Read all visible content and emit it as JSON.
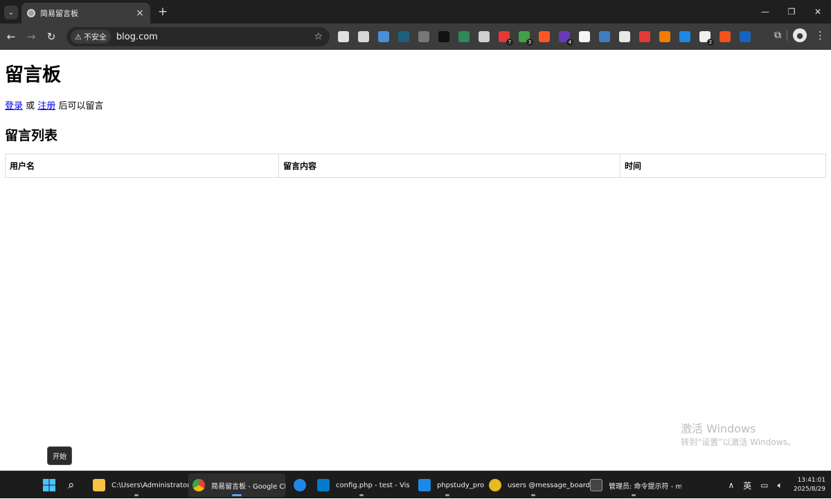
{
  "browser": {
    "tab_title": "简易留言板",
    "url": "blog.com",
    "security_label": "不安全",
    "extensions": [
      {
        "name": "ext-1",
        "color": "#e0e0e0",
        "badge": ""
      },
      {
        "name": "ext-2",
        "color": "#d8d8d8",
        "badge": ""
      },
      {
        "name": "ext-3",
        "color": "#4a90d9",
        "badge": ""
      },
      {
        "name": "ext-4",
        "color": "#1f5f7a",
        "badge": ""
      },
      {
        "name": "ext-5",
        "color": "#777777",
        "badge": ""
      },
      {
        "name": "ext-6",
        "color": "#111111",
        "badge": ""
      },
      {
        "name": "ext-7",
        "color": "#2e8b57",
        "badge": ""
      },
      {
        "name": "ext-8",
        "color": "#cfcfcf",
        "badge": ""
      },
      {
        "name": "ext-9",
        "color": "#e53935",
        "badge": "7"
      },
      {
        "name": "ext-10",
        "color": "#43a047",
        "badge": "3"
      },
      {
        "name": "ext-11",
        "color": "#ff5722",
        "badge": ""
      },
      {
        "name": "ext-12",
        "color": "#673ab7",
        "badge": "4"
      },
      {
        "name": "ext-13",
        "color": "#f4f4f4",
        "badge": ""
      },
      {
        "name": "ext-14",
        "color": "#3f7fbf",
        "badge": ""
      },
      {
        "name": "ext-15",
        "color": "#e8e8e8",
        "badge": ""
      },
      {
        "name": "ext-16",
        "color": "#e53935",
        "badge": ""
      },
      {
        "name": "ext-17",
        "color": "#f57c00",
        "badge": ""
      },
      {
        "name": "ext-18",
        "color": "#1e88e5",
        "badge": ""
      },
      {
        "name": "ext-19",
        "color": "#eeeeee",
        "badge": "2"
      },
      {
        "name": "ext-20",
        "color": "#f4511e",
        "badge": ""
      },
      {
        "name": "ext-21",
        "color": "#1565c0",
        "badge": ""
      }
    ]
  },
  "page": {
    "title": "留言板",
    "login_link": "登录",
    "or_text": "或",
    "register_link": "注册",
    "suffix_text": "后可以留言",
    "list_heading": "留言列表",
    "table_headers": [
      "用户名",
      "留言内容",
      "时间"
    ]
  },
  "watermark": {
    "line1": "激活 Windows",
    "line2": "转到“设置”以激活 Windows。"
  },
  "tooltip": "开始",
  "taskbar": {
    "items": [
      {
        "label": "C:\\Users\\Administrator\\",
        "color": "#f6c343"
      },
      {
        "label": "简易留言板 - Google Ch",
        "color": "#34a853"
      },
      {
        "label": "",
        "color": "#1e88e5"
      },
      {
        "label": "config.php - test - Visua",
        "color": "#007acc"
      },
      {
        "label": "phpstudy_pro",
        "color": "#1e88e5"
      },
      {
        "label": "users @message_board",
        "color": "#e8b923"
      },
      {
        "label": "管理员: 命令提示符 - my",
        "color": "#444444"
      }
    ],
    "tray_ime": "英",
    "time": "13:41:01",
    "date": "2025/8/29"
  }
}
